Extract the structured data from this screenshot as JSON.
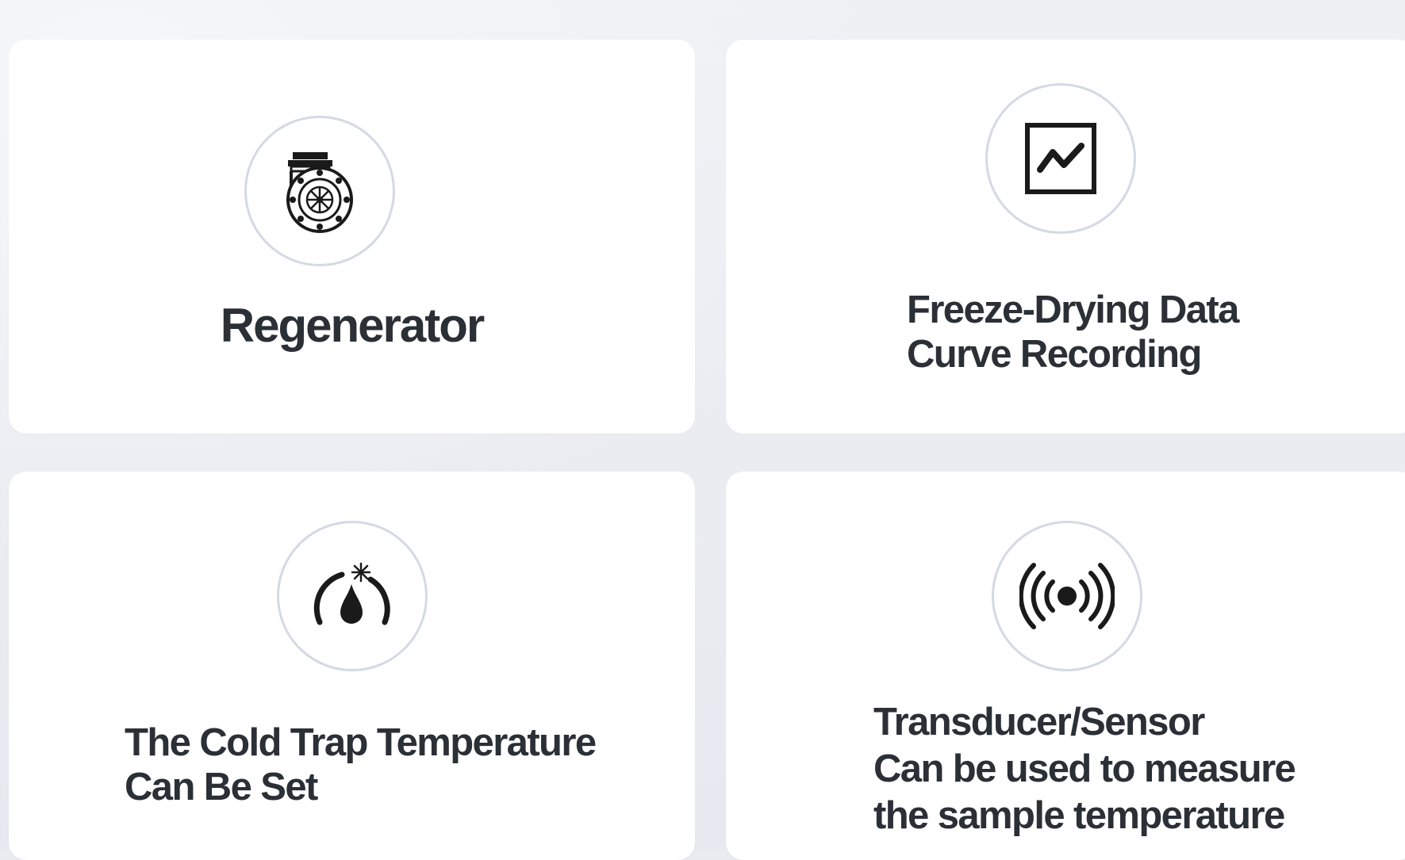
{
  "features": [
    {
      "icon": "regenerator-icon",
      "lines": [
        "Regenerator"
      ]
    },
    {
      "icon": "data-curve-icon",
      "lines": [
        "Freeze-Drying Data",
        "Curve Recording"
      ]
    },
    {
      "icon": "cold-trap-gauge-icon",
      "lines": [
        "The Cold Trap Temperature",
        "Can Be Set"
      ]
    },
    {
      "icon": "sensor-signal-icon",
      "lines": [
        "Transducer/Sensor",
        "Can be used to measure",
        "the sample temperature"
      ]
    }
  ],
  "colors": {
    "background": "#e9ebf0",
    "card": "#ffffff",
    "text": "#2b2f36",
    "icon_ring": "#d5d9e4",
    "icon": "#1a1a1a"
  }
}
